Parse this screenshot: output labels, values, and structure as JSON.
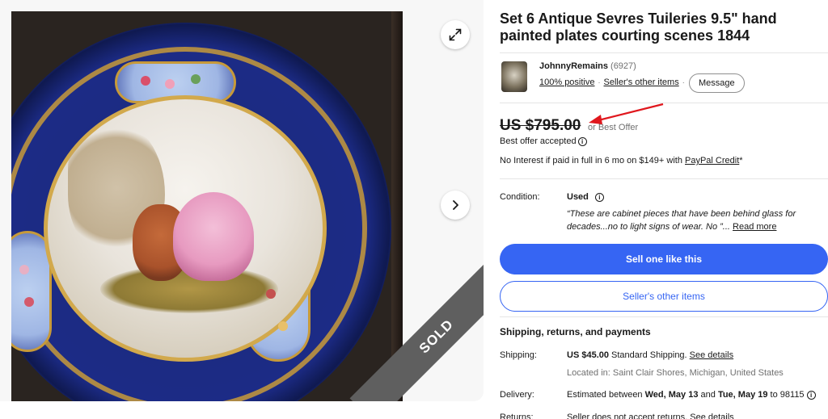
{
  "gallery": {
    "sold_label": "SOLD"
  },
  "listing": {
    "title": "Set 6 Antique Sevres Tuileries 9.5\" hand painted plates courting scenes 1844"
  },
  "seller": {
    "name": "JohnnyRemains",
    "feedback_count": "(6927)",
    "positive_label": "100% positive",
    "other_items_label": "Seller's other items",
    "separator": "·",
    "message_label": "Message"
  },
  "price": {
    "amount": "US $795.00",
    "offer_text": "or Best Offer",
    "offer_accepted": "Best offer accepted",
    "credit_prefix": "No Interest if paid in full in 6 mo on $149+ with ",
    "credit_link": "PayPal Credit",
    "credit_suffix": "*"
  },
  "condition": {
    "label": "Condition:",
    "value": "Used",
    "description": "“These are cabinet pieces that have been behind glass for decades...no to light signs of wear. No ”... ",
    "read_more": "Read more"
  },
  "actions": {
    "primary": "Sell one like this",
    "secondary": "Seller's other items"
  },
  "shipping": {
    "heading": "Shipping, returns, and payments",
    "shipping_label": "Shipping:",
    "shipping_price": "US $45.00",
    "shipping_method": " Standard Shipping. ",
    "see_details": "See details",
    "location": "Located in: Saint Clair Shores, Michigan, United States",
    "delivery_label": "Delivery:",
    "delivery_prefix": "Estimated between ",
    "delivery_start": "Wed, May 13",
    "delivery_and": " and ",
    "delivery_end": "Tue, May 19",
    "delivery_suffix": " to 98115",
    "returns_label": "Returns:",
    "returns_value": "Seller does not accept returns. ",
    "returns_details": "See details"
  },
  "colors": {
    "accent_blue": "#3665f3",
    "arrow_red": "#e0171d",
    "sold_ribbon": "#5f5f5f"
  },
  "icons": [
    "expand-icon",
    "chevron-right-icon",
    "info-icon",
    "arrow-annotation"
  ]
}
